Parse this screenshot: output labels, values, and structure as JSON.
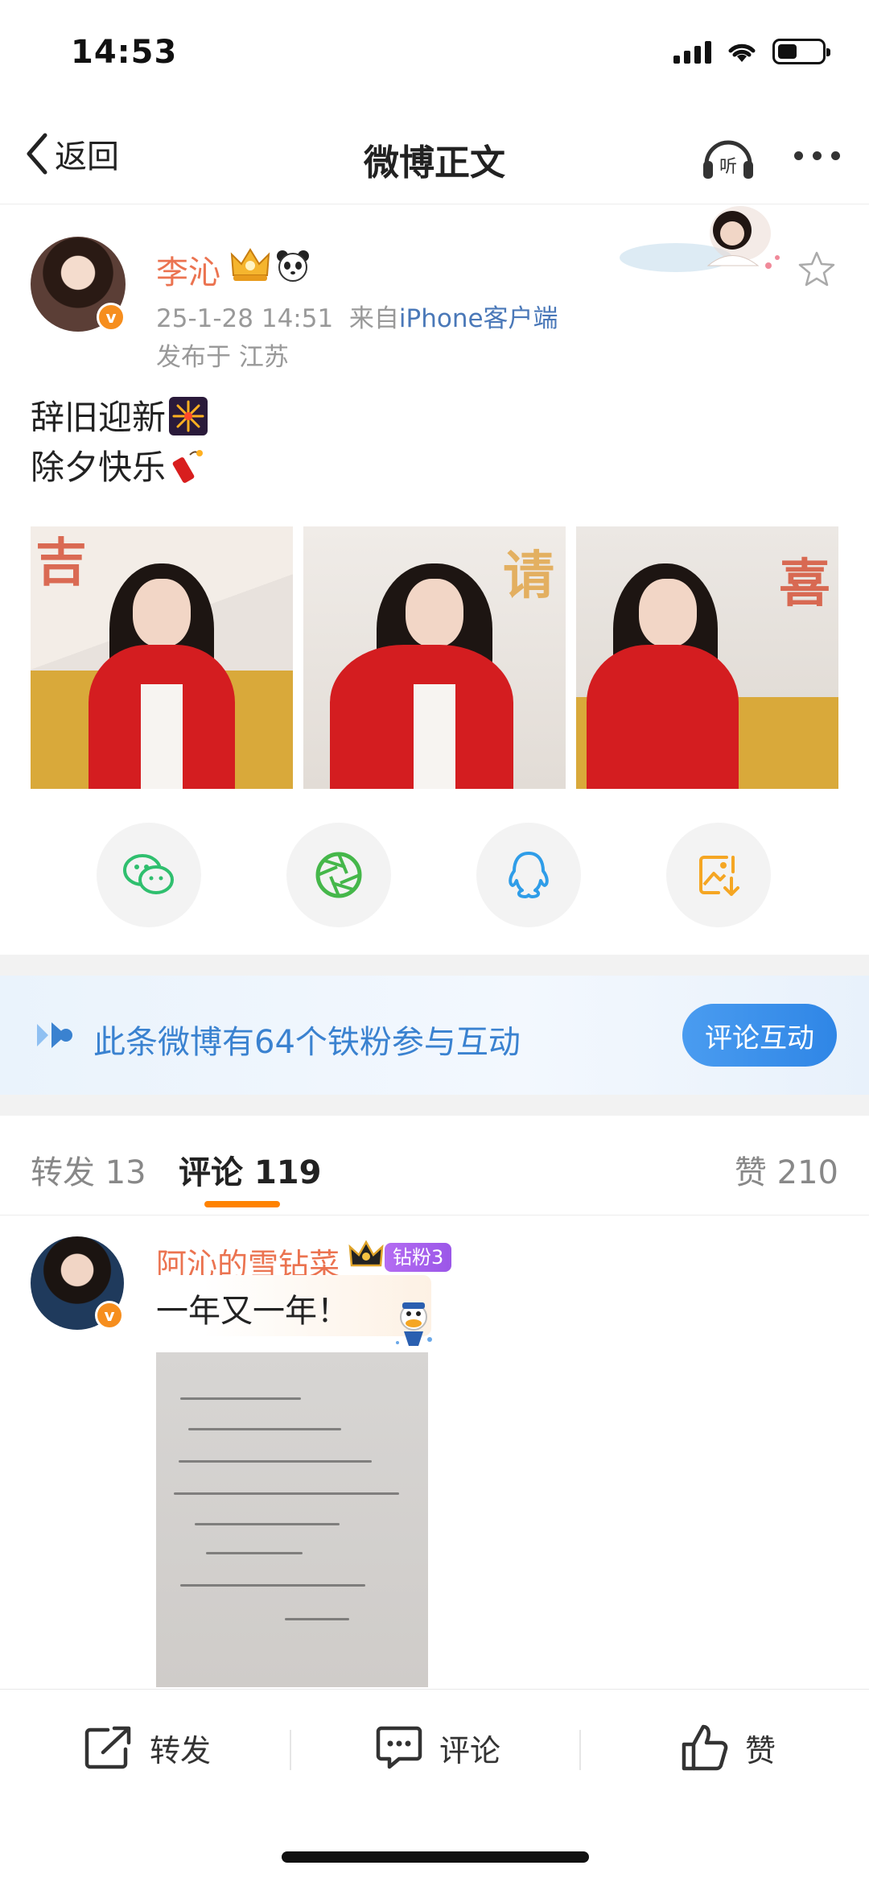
{
  "status": {
    "time": "14:53"
  },
  "nav": {
    "back_label": "返回",
    "title": "微博正文",
    "listen_label": "听"
  },
  "post": {
    "author": "李沁",
    "vbadge": "v",
    "timestamp": "25-1-28 14:51",
    "source_prefix": "来自",
    "source": "iPhone客户端",
    "location": "发布于 江苏",
    "text_line1": "辞旧迎新",
    "text_line2": "除夕快乐",
    "photos": [
      {
        "callig": "吉"
      },
      {
        "callig": "请"
      },
      {
        "callig": "喜"
      }
    ]
  },
  "share": [
    "wechat-icon",
    "moments-icon",
    "qq-icon",
    "save-image-icon"
  ],
  "fans_banner": {
    "text": "此条微博有64个铁粉参与互动",
    "button": "评论互动"
  },
  "tabs": {
    "repost_label": "转发",
    "repost_count": "13",
    "comment_label": "评论",
    "comment_count": "119",
    "like_label": "赞",
    "like_count": "210"
  },
  "comment": {
    "author": "阿沁的雪钻菜",
    "fan_badge": "钻粉3",
    "vbadge": "v",
    "text": "一年又一年！"
  },
  "actions": {
    "repost": "转发",
    "comment": "评论",
    "like": "赞"
  },
  "colors": {
    "accent_orange": "#ff8200",
    "name_orange": "#eb7350",
    "link_blue": "#4a78b8",
    "button_blue": "#2f86e6"
  }
}
